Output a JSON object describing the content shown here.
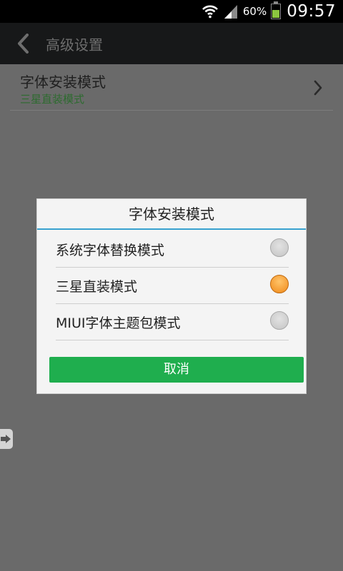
{
  "status_bar": {
    "battery": "60%",
    "time": "09:57"
  },
  "action_bar": {
    "title": "高级设置"
  },
  "settings": {
    "item": {
      "title": "字体安装模式",
      "subtitle": "三星直装模式"
    }
  },
  "dialog": {
    "title": "字体安装模式",
    "options": [
      {
        "label": "系统字体替换模式",
        "selected": false
      },
      {
        "label": "三星直装模式",
        "selected": true
      },
      {
        "label": "MIUI字体主题包模式",
        "selected": false
      }
    ],
    "cancel_label": "取消"
  },
  "colors": {
    "accent_green": "#1fae4e",
    "dialog_divider_blue": "#37a1cf",
    "radio_selected_orange": "#f08a1a",
    "subtitle_green": "#2d6b2f"
  },
  "icons": [
    "wifi-icon",
    "signal-icon",
    "battery-icon",
    "back-arrow-icon",
    "chevron-right-icon",
    "side-tab-arrow-icon"
  ]
}
